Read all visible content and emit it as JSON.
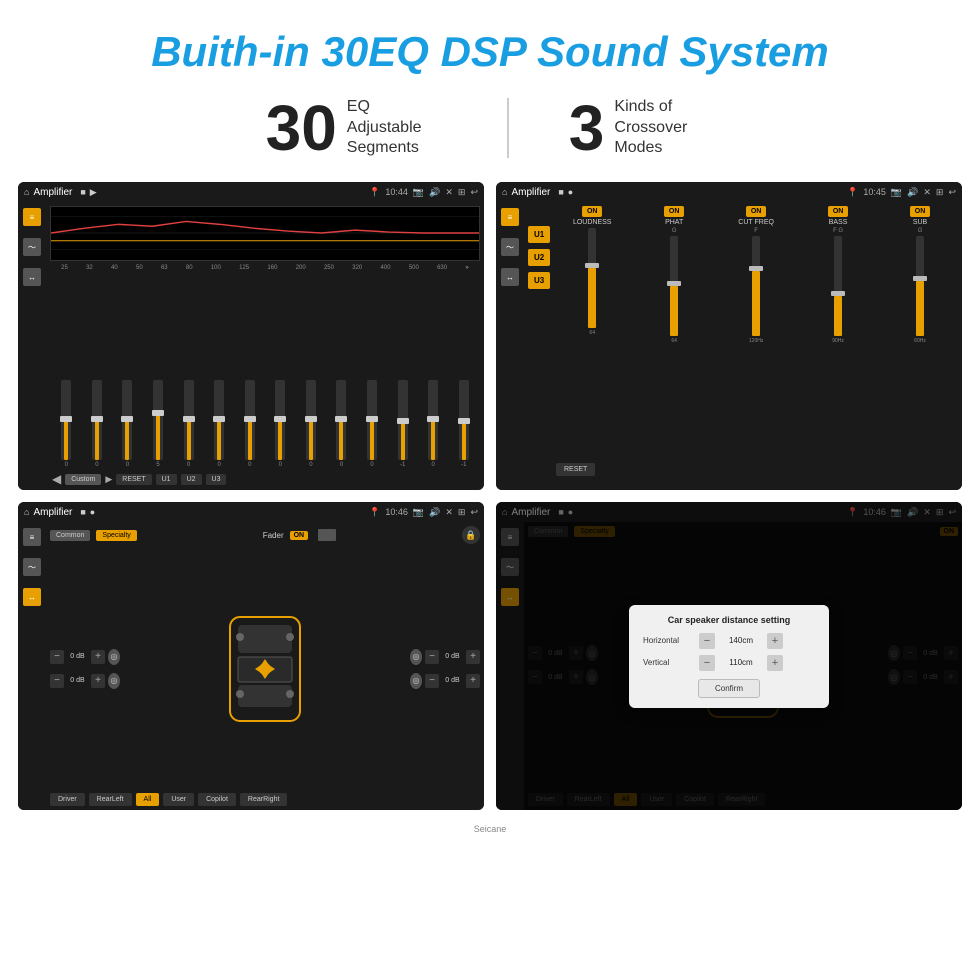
{
  "header": {
    "title": "Buith-in 30EQ DSP Sound System"
  },
  "stats": {
    "left_number": "30",
    "left_label_line1": "EQ Adjustable",
    "left_label_line2": "Segments",
    "right_number": "3",
    "right_label_line1": "Kinds of",
    "right_label_line2": "Crossover Modes"
  },
  "screen1": {
    "title": "Amplifier",
    "time": "10:44",
    "freq_labels": [
      "25",
      "32",
      "40",
      "50",
      "63",
      "80",
      "100",
      "125",
      "160",
      "200",
      "250",
      "320",
      "400",
      "500",
      "630"
    ],
    "fader_values": [
      "0",
      "0",
      "0",
      "5",
      "0",
      "0",
      "0",
      "0",
      "0",
      "0",
      "0",
      "-1",
      "0",
      "-1"
    ],
    "buttons": [
      "Custom",
      "RESET",
      "U1",
      "U2",
      "U3"
    ]
  },
  "screen2": {
    "title": "Amplifier",
    "time": "10:45",
    "u_buttons": [
      "U1",
      "U2",
      "U3"
    ],
    "channels": [
      {
        "label": "LOUDNESS",
        "on": true
      },
      {
        "label": "PHAT",
        "on": true
      },
      {
        "label": "CUT FREQ",
        "on": true
      },
      {
        "label": "BASS",
        "on": true
      },
      {
        "label": "SUB",
        "on": true
      }
    ]
  },
  "screen3": {
    "title": "Amplifier",
    "time": "10:46",
    "tabs": [
      "Common",
      "Specialty"
    ],
    "fader_label": "Fader",
    "on_text": "ON",
    "controls": {
      "top_left": "0 dB",
      "bottom_left": "0 dB",
      "top_right": "0 dB",
      "bottom_right": "0 dB"
    },
    "bottom_buttons": [
      "Driver",
      "RearLeft",
      "All",
      "User",
      "Copilot",
      "RearRight"
    ]
  },
  "screen4": {
    "title": "Amplifier",
    "time": "10:46",
    "tabs": [
      "Common",
      "Specialty"
    ],
    "on_text": "ON",
    "modal": {
      "title": "Car speaker distance setting",
      "horizontal_label": "Horizontal",
      "horizontal_value": "140cm",
      "vertical_label": "Vertical",
      "vertical_value": "110cm",
      "right_top": "0 dB",
      "right_bottom": "0 dB",
      "confirm_label": "Confirm"
    },
    "bottom_buttons": [
      "Driver",
      "RearLeft",
      "All",
      "User",
      "Copilot",
      "RearRight"
    ]
  },
  "watermark": "Seicane"
}
